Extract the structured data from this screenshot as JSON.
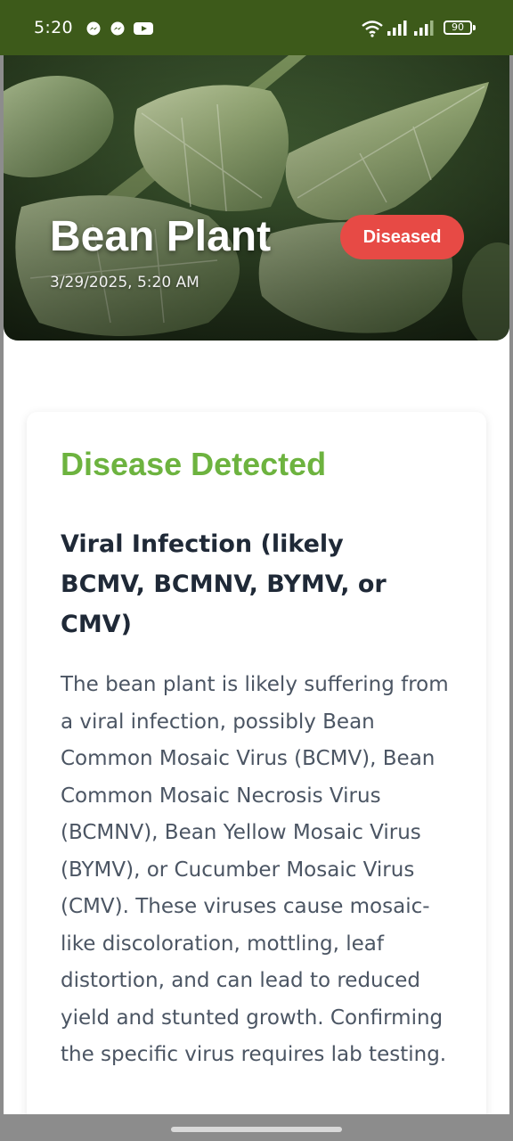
{
  "status_bar": {
    "time": "5:20",
    "app_icons": [
      "messenger-icon",
      "messenger-icon",
      "youtube-icon"
    ],
    "battery_level": "90",
    "indicators": [
      "wifi-icon",
      "signal-icon",
      "signal-icon",
      "battery-icon"
    ],
    "background_color": "#3d5a1a"
  },
  "hero": {
    "plant_name": "Bean Plant",
    "timestamp": "3/29/2025, 5:20 AM",
    "status_label": "Diseased",
    "status_color": "#e74a45"
  },
  "result_card": {
    "heading": "Disease Detected",
    "heading_color": "#6db33f",
    "disease_name": "Viral Infection (likely BCMV, BCMNV, BYMV, or CMV)",
    "description": "The bean plant is likely suffering from a viral infection, possibly Bean Common Mosaic Virus (BCMV), Bean Common Mosaic Necrosis Virus (BCMNV), Bean Yellow Mosaic Virus (BYMV), or Cucumber Mosaic Virus (CMV). These viruses cause mosaic-like discoloration, mottling, leaf distortion, and can lead to reduced yield and stunted growth. Confirming the specific virus requires lab testing."
  }
}
